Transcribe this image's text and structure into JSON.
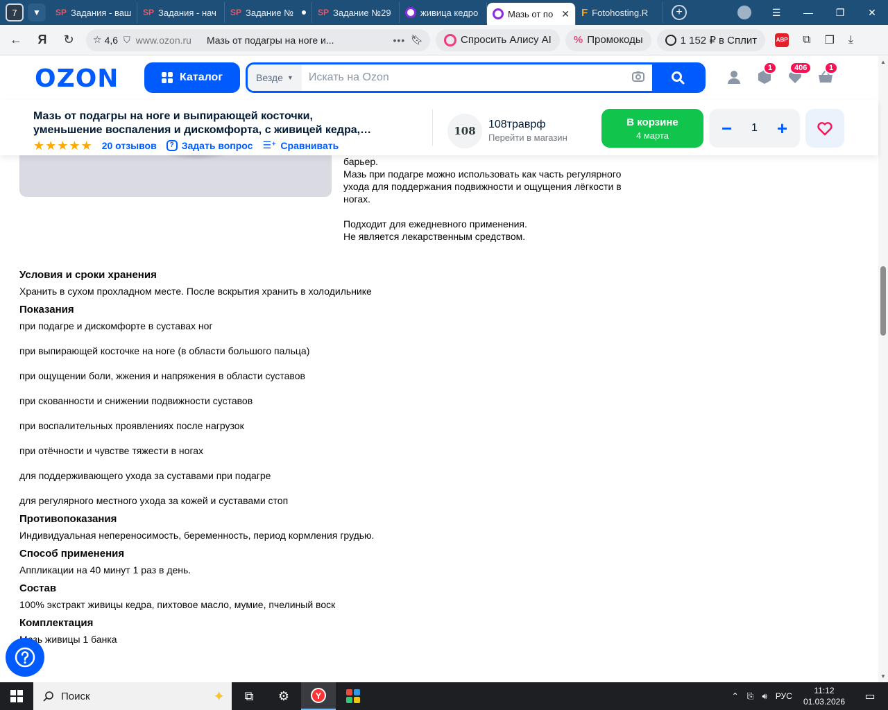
{
  "browser": {
    "tab_count": "7",
    "tabs": [
      {
        "favicon": "SP",
        "title": "Задания - ваш"
      },
      {
        "favicon": "SP",
        "title": "Задания - нач"
      },
      {
        "favicon": "SP",
        "title": "Задание №"
      },
      {
        "favicon": "SP",
        "title": "Задание №29"
      },
      {
        "favicon": "ozon",
        "title": "живица кедро"
      },
      {
        "favicon": "ozon",
        "title": "Мазь от по"
      },
      {
        "favicon": "F",
        "title": "Fotohosting.R"
      }
    ],
    "address": {
      "rating": "4,6",
      "domain": "www.ozon.ru",
      "page_title": "Мазь от подагры на ноге и..."
    },
    "pills": {
      "alice": "Спросить Алису AI",
      "promo": "Промокоды",
      "split": "1 152 ₽ в Сплит"
    },
    "abp": "ABP"
  },
  "header": {
    "logo": "OZON",
    "catalog": "Каталог",
    "search_scope": "Везде",
    "search_placeholder": "Искать на Ozon",
    "badges": {
      "orders": "1",
      "favorites": "406",
      "cart": "1"
    }
  },
  "product": {
    "title_line1": "Мазь от подагры на ноге и выпирающей косточки,",
    "title_line2": "уменьшение воспаления и дискомфорта, с живицей кедра,…",
    "reviews": "20 отзывов",
    "ask": "Задать вопрос",
    "compare": "Сравнивать",
    "rating_stars": 5,
    "store_logo_text": "108",
    "store_name": "108траврф",
    "store_link": "Перейти в магазин",
    "cart_label": "В корзине",
    "cart_date": "4 марта",
    "qty": "1"
  },
  "description": {
    "line1": "барьер.",
    "p2": "Мазь при подагре можно использовать как часть регулярного ухода для поддержания подвижности и ощущения лёгкости в ногах.",
    "p3a": "Подходит для ежедневного применения.",
    "p3b": "Не является лекарственным средством."
  },
  "specs": {
    "storage_title": "Условия и сроки хранения",
    "storage_text": "Хранить в сухом прохладном месте. После вскрытия хранить в холодильнике",
    "indications_title": "Показания",
    "indications": [
      "при подагре и дискомфорте в суставах ног",
      "при выпирающей косточке на ноге (в области большого пальца)",
      "при ощущении боли, жжения и напряжения в области суставов",
      "при скованности и снижении подвижности суставов",
      "при воспалительных проявлениях после нагрузок",
      "при отёчности и чувстве тяжести в ногах",
      "для поддерживающего ухода за суставами при подагре",
      "для регулярного местного ухода за кожей и суставами стоп"
    ],
    "contra_title": "Противопоказания",
    "contra_text": "Индивидуальная непереносимость, беременность, период кормления грудью.",
    "usage_title": "Способ применения",
    "usage_text": "Аппликации на 40 минут 1 раз в день.",
    "composition_title": "Состав",
    "composition_text": "100% экстракт живицы кедра, пихтовое масло, мумие, пчелиный воск",
    "kit_title": "Комплектация",
    "kit_text": "Мазь живицы 1 банка"
  },
  "taskbar": {
    "search": "Поиск",
    "lang": "РУС",
    "time": "11:12",
    "date": "01.03.2026"
  },
  "colors": {
    "accent": "#005bff",
    "cart": "#10c44c",
    "badge": "#f91155",
    "star": "#ffa800"
  }
}
